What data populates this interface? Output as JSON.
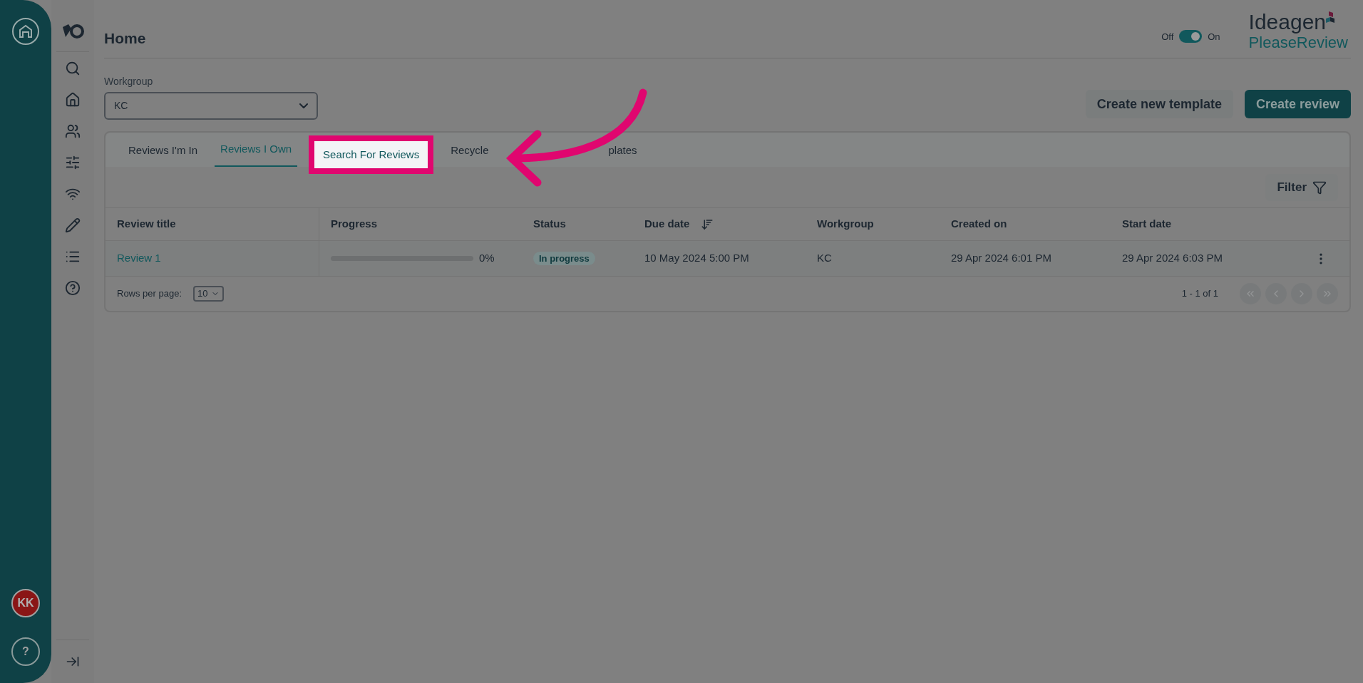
{
  "rail": {
    "avatar": "KK",
    "help": "?"
  },
  "nav": [
    {
      "kind": "search"
    },
    {
      "kind": "home"
    },
    {
      "kind": "users"
    },
    {
      "kind": "sliders"
    },
    {
      "kind": "wifi"
    },
    {
      "kind": "pencil"
    },
    {
      "kind": "list"
    },
    {
      "kind": "help"
    }
  ],
  "header": {
    "title": "Home",
    "toggle": {
      "off_label": "Off",
      "on_label": "On",
      "on": true
    },
    "logo": {
      "brand": "Ideagen",
      "product": "PleaseReview"
    }
  },
  "workgroup": {
    "label": "Workgroup",
    "value": "KC"
  },
  "actions": [
    {
      "label": "Create new template",
      "kind": "secondary"
    },
    {
      "label": "Create review",
      "kind": "primary"
    }
  ],
  "tabs": [
    {
      "label": "Reviews I'm In",
      "selected": false,
      "spotlight": false
    },
    {
      "label": "Reviews I Own",
      "selected": true,
      "spotlight": false
    },
    {
      "label": "Search For Reviews",
      "selected": false,
      "spotlight": true
    },
    {
      "label": "Recycle",
      "selected": false,
      "spotlight": false
    },
    {
      "label": "plates",
      "selected": false,
      "spotlight": false
    }
  ],
  "filter": {
    "label": "Filter"
  },
  "table": {
    "columns": [
      "Review title",
      "Progress",
      "Status",
      "Due date",
      "Workgroup",
      "Created on",
      "Start date"
    ],
    "rows": [
      {
        "title": "Review 1",
        "level": 0,
        "progress": "0%",
        "status": "In progress",
        "due": "10 May 2024 5:00 PM",
        "workgroup": "KC",
        "created": "29 Apr 2024 6:01 PM",
        "start": "29 Apr 2024 6:03 PM"
      }
    ]
  },
  "footer": {
    "rows_label": "Rows per page:",
    "rows_value": "10",
    "range": "1 - 1 of 1",
    "pager": [
      {
        "kind": "first",
        "disabled": true
      },
      {
        "kind": "prev",
        "disabled": true
      },
      {
        "kind": "next",
        "disabled": true
      },
      {
        "kind": "last",
        "disabled": true
      }
    ]
  }
}
